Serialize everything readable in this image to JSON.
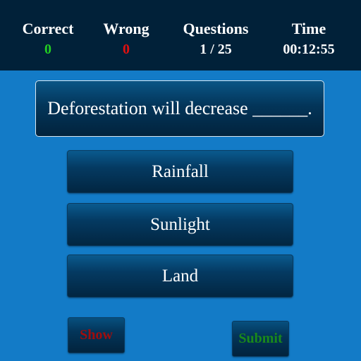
{
  "stats": {
    "correct": {
      "label": "Correct",
      "value": "0"
    },
    "wrong": {
      "label": "Wrong",
      "value": "0"
    },
    "questions": {
      "label": "Questions",
      "value": "1 / 25"
    },
    "time": {
      "label": "Time",
      "value": "00:12:55"
    }
  },
  "question": {
    "text": "Deforestation will decrease ______."
  },
  "options": [
    {
      "label": "Rainfall"
    },
    {
      "label": "Sunlight"
    },
    {
      "label": "Land"
    }
  ],
  "actions": {
    "show_label": "Show",
    "submit_label": "Submit"
  },
  "colors": {
    "background": "#137bc7",
    "header": "#012139",
    "correct": "#22cc22",
    "wrong": "#e01010",
    "show_text": "#a00d0d",
    "submit_text": "#1a8a1a"
  }
}
